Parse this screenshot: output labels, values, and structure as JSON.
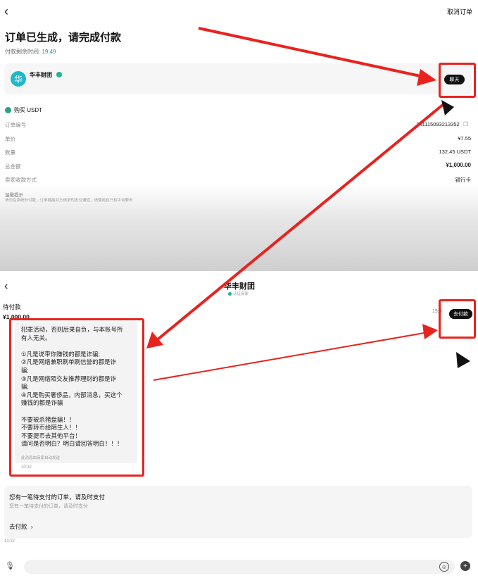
{
  "top": {
    "back_icon": "back-chevron",
    "cancel_order": "取消订单",
    "title": "订单已生成，请完成付款",
    "countdown_label": "付款剩余时间:",
    "countdown_value": "19:49",
    "merchant_name": "华丰财团",
    "avatar_char": "华",
    "chat_button": "聊天",
    "buy_label": "购买 USDT",
    "rows": [
      {
        "label": "订单编号",
        "value": "241115093213352"
      },
      {
        "label": "单价",
        "value": "¥7.55"
      },
      {
        "label": "数量",
        "value": "132.45 USDT"
      },
      {
        "label": "总金额",
        "value": "¥1,000.00"
      },
      {
        "label": "卖家收款方式",
        "value": "银行卡"
      }
    ],
    "tips_title": "温馨提示",
    "tips_text": "请勿在系统外付款，订单链接对方请求的支付通道，请使用且只有平台聊天"
  },
  "bottom": {
    "back_icon": "back-chevron",
    "chat_title": "华丰财团",
    "chat_subtitle": "认证商家",
    "pending_label": "待付款",
    "pending_amount": "¥1,000.00",
    "time_partial": "19:4",
    "go_pay_button": "去付款",
    "message_lines": [
      "犯罪活动，否则后果自负，与本账号所",
      "有人无关。",
      "",
      "①凡是说带你赚钱的都是诈骗;",
      "②凡是网络兼职刷单刷信誉的都是诈",
      "骗;",
      "③凡是网络陌交友推荐理财的都是诈",
      "骗;",
      "④凡是购买奢侈品，内部消息，买这个",
      "赚钱的都是诈骗",
      "",
      "不要被杀猪盘骗！！",
      "不要转币给陌生人！！",
      "不要提币去其他平台！",
      "请问是否明白？明白请回答明白！！！"
    ],
    "message_footnote": "此消息由商家自动发送",
    "message_time": "10:32",
    "notice_title": "您有一笔待支付的订单，请及时支付",
    "notice_sub": "您有一笔待支付的订单，请及时支付",
    "notice_link": "去付款",
    "notice_time": "10:32",
    "input_placeholder": ""
  },
  "colors": {
    "annotation_red": "#e8231f",
    "accent_teal": "#1db8c7",
    "verified_green": "#1fb394",
    "button_black": "#111111"
  }
}
